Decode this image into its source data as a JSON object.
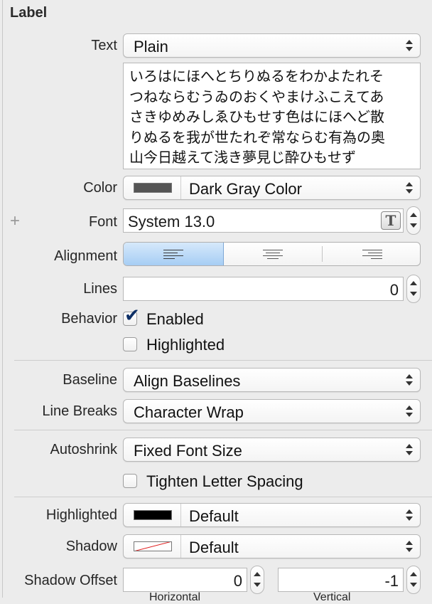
{
  "section_title": "Label",
  "text": {
    "label": "Text",
    "type_value": "Plain",
    "content_lines": [
      "いろはにほへとちりぬるをわかよたれそ",
      "つねならむうゐのおくやまけふこえてあ",
      "さきゆめみしゑひもせす色はにほへど散",
      "りぬるを我が世たれぞ常ならむ有為の奥",
      "山今日越えて浅き夢見じ酔ひもせず"
    ]
  },
  "color": {
    "label": "Color",
    "value": "Dark Gray Color",
    "swatch": "#555555"
  },
  "font": {
    "label": "Font",
    "value": "System 13.0",
    "add_glyph": "+",
    "picker_glyph": "T"
  },
  "alignment": {
    "label": "Alignment",
    "options": [
      "left",
      "center",
      "right"
    ],
    "selected": "left"
  },
  "lines": {
    "label": "Lines",
    "value": "0"
  },
  "behavior": {
    "label": "Behavior",
    "enabled": {
      "label": "Enabled",
      "checked": true
    },
    "highlighted": {
      "label": "Highlighted",
      "checked": false
    }
  },
  "baseline": {
    "label": "Baseline",
    "value": "Align Baselines"
  },
  "line_breaks": {
    "label": "Line Breaks",
    "value": "Character Wrap"
  },
  "autoshrink": {
    "label": "Autoshrink",
    "value": "Fixed Font Size"
  },
  "tighten": {
    "label": "Tighten Letter Spacing",
    "checked": false
  },
  "highlighted_color": {
    "label": "Highlighted",
    "value": "Default",
    "swatch": "#000000"
  },
  "shadow": {
    "label": "Shadow",
    "value": "Default"
  },
  "shadow_offset": {
    "label": "Shadow Offset",
    "horizontal_value": "0",
    "vertical_value": "-1",
    "horizontal_caption": "Horizontal",
    "vertical_caption": "Vertical"
  }
}
